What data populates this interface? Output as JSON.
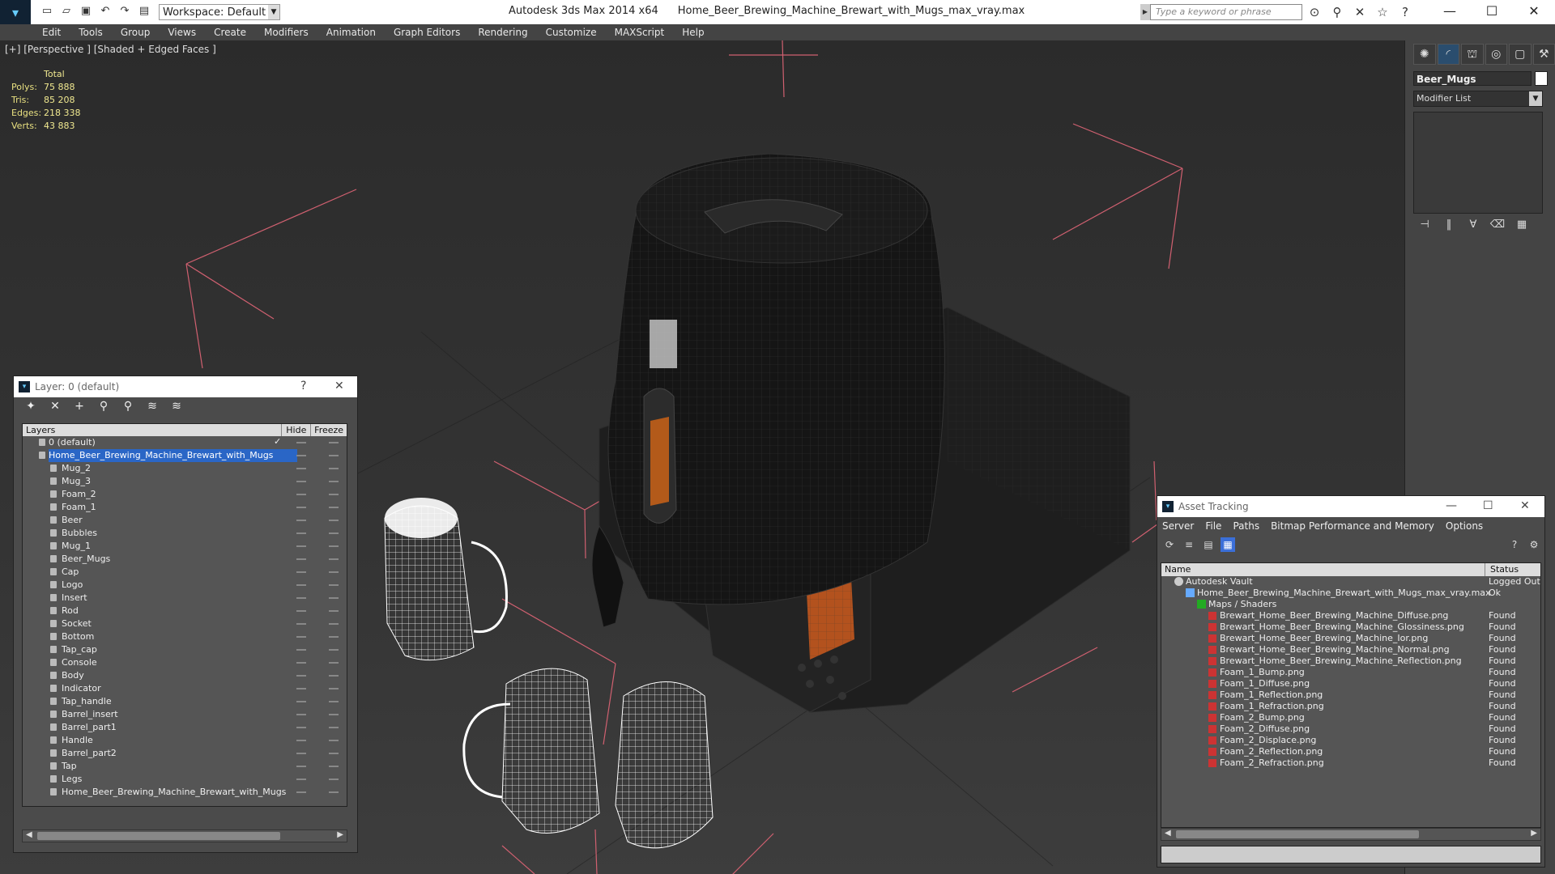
{
  "app": {
    "product": "Autodesk 3ds Max",
    "version": "2014 x64",
    "file": "Home_Beer_Brewing_Machine_Brewart_with_Mugs_max_vray.max",
    "workspace": "Workspace: Default",
    "search_placeholder": "Type a keyword or phrase"
  },
  "menu": [
    "Edit",
    "Tools",
    "Group",
    "Views",
    "Create",
    "Modifiers",
    "Animation",
    "Graph Editors",
    "Rendering",
    "Customize",
    "MAXScript",
    "Help"
  ],
  "viewport": {
    "label": "[+] [Perspective ] [Shaded + Edged Faces ]",
    "stats": {
      "header": "Total",
      "rows": [
        {
          "k": "Polys:",
          "v": "75 888"
        },
        {
          "k": "Tris:",
          "v": "85 208"
        },
        {
          "k": "Edges:",
          "v": "218 338"
        },
        {
          "k": "Verts:",
          "v": "43 883"
        }
      ]
    }
  },
  "command_panel": {
    "object_name": "Beer_Mugs",
    "modifier_list": "Modifier List"
  },
  "layer_panel": {
    "title": "Layer: 0 (default)",
    "help": "?",
    "col_layers": "Layers",
    "col_hide": "Hide",
    "col_freeze": "Freeze",
    "rows": [
      {
        "name": "0 (default)",
        "level": 0,
        "check": "✓"
      },
      {
        "name": "Home_Beer_Brewing_Machine_Brewart_with_Mugs",
        "level": 0,
        "selected": true
      },
      {
        "name": "Mug_2",
        "level": 1
      },
      {
        "name": "Mug_3",
        "level": 1
      },
      {
        "name": "Foam_2",
        "level": 1
      },
      {
        "name": "Foam_1",
        "level": 1
      },
      {
        "name": "Beer",
        "level": 1
      },
      {
        "name": "Bubbles",
        "level": 1
      },
      {
        "name": "Mug_1",
        "level": 1
      },
      {
        "name": "Beer_Mugs",
        "level": 1
      },
      {
        "name": "Cap",
        "level": 1
      },
      {
        "name": "Logo",
        "level": 1
      },
      {
        "name": "Insert",
        "level": 1
      },
      {
        "name": "Rod",
        "level": 1
      },
      {
        "name": "Socket",
        "level": 1
      },
      {
        "name": "Bottom",
        "level": 1
      },
      {
        "name": "Tap_cap",
        "level": 1
      },
      {
        "name": "Console",
        "level": 1
      },
      {
        "name": "Body",
        "level": 1
      },
      {
        "name": "Indicator",
        "level": 1
      },
      {
        "name": "Tap_handle",
        "level": 1
      },
      {
        "name": "Barrel_insert",
        "level": 1
      },
      {
        "name": "Barrel_part1",
        "level": 1
      },
      {
        "name": "Handle",
        "level": 1
      },
      {
        "name": "Barrel_part2",
        "level": 1
      },
      {
        "name": "Tap",
        "level": 1
      },
      {
        "name": "Legs",
        "level": 1
      },
      {
        "name": "Home_Beer_Brewing_Machine_Brewart_with_Mugs",
        "level": 1
      }
    ]
  },
  "asset_panel": {
    "title": "Asset Tracking",
    "menu": [
      "Server",
      "File",
      "Paths",
      "Bitmap Performance and Memory",
      "Options"
    ],
    "col_name": "Name",
    "col_status": "Status",
    "rows": [
      {
        "name": "Autodesk Vault",
        "status": "Logged Out",
        "level": 0,
        "icon": "vault"
      },
      {
        "name": "Home_Beer_Brewing_Machine_Brewart_with_Mugs_max_vray.max",
        "status": "Ok",
        "level": 1,
        "icon": "doc"
      },
      {
        "name": "Maps / Shaders",
        "status": "",
        "level": 2,
        "icon": "map"
      },
      {
        "name": "Brewart_Home_Beer_Brewing_Machine_Diffuse.png",
        "status": "Found",
        "level": 3,
        "icon": "file"
      },
      {
        "name": "Brewart_Home_Beer_Brewing_Machine_Glossiness.png",
        "status": "Found",
        "level": 3,
        "icon": "file"
      },
      {
        "name": "Brewart_Home_Beer_Brewing_Machine_Ior.png",
        "status": "Found",
        "level": 3,
        "icon": "file"
      },
      {
        "name": "Brewart_Home_Beer_Brewing_Machine_Normal.png",
        "status": "Found",
        "level": 3,
        "icon": "file"
      },
      {
        "name": "Brewart_Home_Beer_Brewing_Machine_Reflection.png",
        "status": "Found",
        "level": 3,
        "icon": "file"
      },
      {
        "name": "Foam_1_Bump.png",
        "status": "Found",
        "level": 3,
        "icon": "file"
      },
      {
        "name": "Foam_1_Diffuse.png",
        "status": "Found",
        "level": 3,
        "icon": "file"
      },
      {
        "name": "Foam_1_Reflection.png",
        "status": "Found",
        "level": 3,
        "icon": "file"
      },
      {
        "name": "Foam_1_Refraction.png",
        "status": "Found",
        "level": 3,
        "icon": "file"
      },
      {
        "name": "Foam_2_Bump.png",
        "status": "Found",
        "level": 3,
        "icon": "file"
      },
      {
        "name": "Foam_2_Diffuse.png",
        "status": "Found",
        "level": 3,
        "icon": "file"
      },
      {
        "name": "Foam_2_Displace.png",
        "status": "Found",
        "level": 3,
        "icon": "file"
      },
      {
        "name": "Foam_2_Reflection.png",
        "status": "Found",
        "level": 3,
        "icon": "file"
      },
      {
        "name": "Foam_2_Refraction.png",
        "status": "Found",
        "level": 3,
        "icon": "file"
      }
    ]
  },
  "colors": {
    "selection": "#2a66c6",
    "bbox": "#d06070",
    "stats_text": "#f0e890"
  }
}
